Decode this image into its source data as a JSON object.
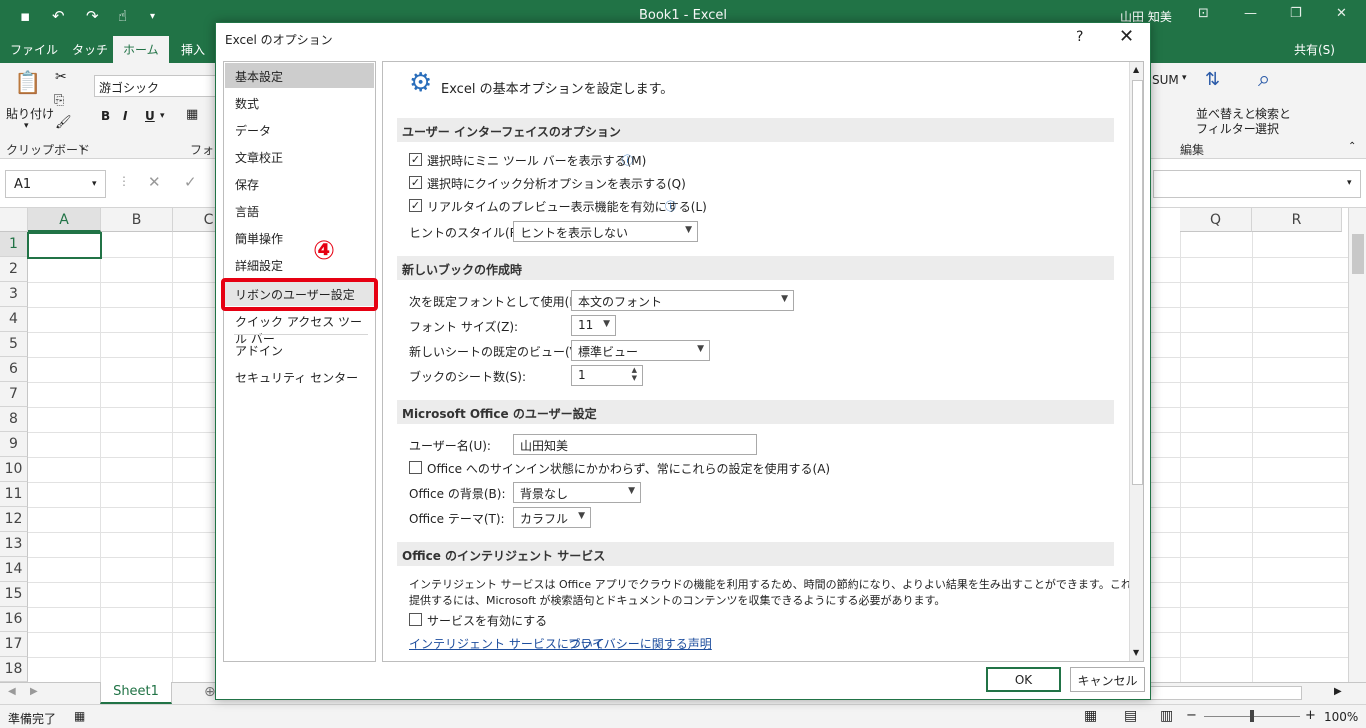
{
  "app": {
    "window_title": "Book1 - Excel",
    "user": "山田 知美",
    "tabs": [
      "ファイル",
      "タッチ",
      "ホーム",
      "挿入"
    ],
    "active_tab": "ホーム",
    "share": "共有(S)",
    "ribbon": {
      "paste": "貼り付け",
      "font_name": "游ゴシック",
      "bold": "B",
      "italic": "I",
      "underline": "U",
      "clipboard_group": "クリップボード",
      "font_group": "フォン",
      "sum_label": "SUM",
      "sort_filter_1": "並べ替えと",
      "sort_filter_2": "フィルター",
      "find_select_1": "検索と",
      "find_select_2": "選択",
      "edit_group": "編集"
    },
    "name_box": "A1",
    "columns": [
      "A",
      "B",
      "C",
      "Q",
      "R"
    ],
    "rows": [
      "1",
      "2",
      "3",
      "4",
      "5",
      "6",
      "7",
      "8",
      "9",
      "10",
      "11",
      "12",
      "13",
      "14",
      "15",
      "16",
      "17",
      "18"
    ],
    "sheet_tab": "Sheet1",
    "status": "準備完了",
    "zoom": "100%"
  },
  "dialog": {
    "title": "Excel のオプション",
    "help": "?",
    "close": "✕",
    "nav": [
      "基本設定",
      "数式",
      "データ",
      "文章校正",
      "保存",
      "言語",
      "簡単操作",
      "詳細設定",
      "リボンのユーザー設定",
      "クイック アクセス ツール バー",
      "アドイン",
      "セキュリティ センター"
    ],
    "selected_nav": "基本設定",
    "highlighted_nav": "リボンのユーザー設定",
    "step_marker": "④",
    "heading": "Excel の基本オプションを設定します。",
    "sections": {
      "ui": "ユーザー インターフェイスのオプション",
      "new_book": "新しいブックの作成時",
      "office_user": "Microsoft Office のユーザー設定",
      "intelligent": "Office のインテリジェント サービス"
    },
    "ui_options": {
      "mini_toolbar": "選択時にミニ ツール バーを表示する(M)",
      "quick_analysis": "選択時にクイック分析オプションを表示する(Q)",
      "live_preview": "リアルタイムのプレビュー表示機能を有効にする(L)",
      "tip_style_label": "ヒントのスタイル(R):",
      "tip_style_value": "ヒントを表示しない"
    },
    "new_book_options": {
      "font_label": "次を既定フォントとして使用(N):",
      "font_value": "本文のフォント",
      "size_label": "フォント サイズ(Z):",
      "size_value": "11",
      "view_label": "新しいシートの既定のビュー(V):",
      "view_value": "標準ビュー",
      "sheets_label": "ブックのシート数(S):",
      "sheets_value": "1"
    },
    "office_user_options": {
      "username_label": "ユーザー名(U):",
      "username_value": "山田知美",
      "always_use": "Office へのサインイン状態にかかわらず、常にこれらの設定を使用する(A)",
      "background_label": "Office の背景(B):",
      "background_value": "背景なし",
      "theme_label": "Office テーマ(T):",
      "theme_value": "カラフル"
    },
    "intelligent_options": {
      "desc_1": "インテリジェント サービスは Office アプリでクラウドの機能を利用するため、時間の節約になり、よりよい結果を生み出すことができます。これらのサービスを",
      "desc_2": "提供するには、Microsoft が検索語句とドキュメントのコンテンツを収集できるようにする必要があります。",
      "enable": "サービスを有効にする",
      "link_about": "インテリジェント サービスについて",
      "link_privacy": "プライバシーに関する声明"
    },
    "ok": "OK",
    "cancel": "キャンセル"
  }
}
